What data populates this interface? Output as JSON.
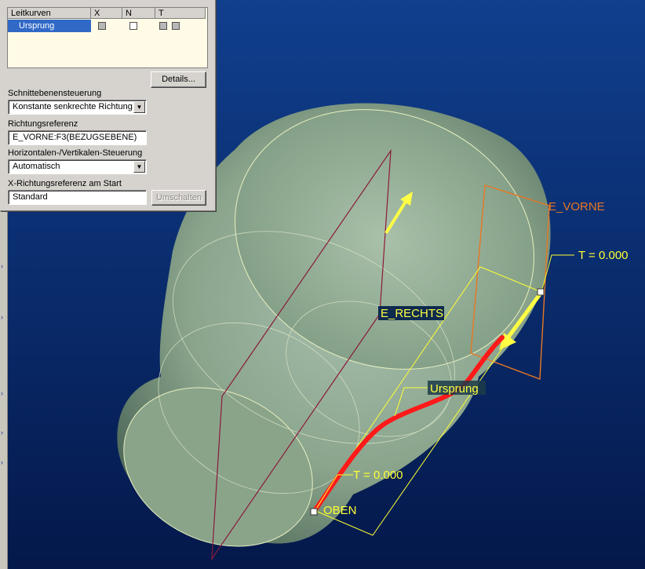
{
  "panel": {
    "table": {
      "columns": [
        "Leitkurven",
        "X",
        "N",
        "T"
      ],
      "rows": [
        {
          "name": "Ursprung"
        }
      ]
    },
    "details_button": "Details...",
    "section_control": {
      "label": "Schnittebenensteuerung",
      "value": "Konstante senkrechte Richtung"
    },
    "direction_ref": {
      "label": "Richtungsreferenz",
      "value": "E_VORNE:F3(BEZUGSEBENE)"
    },
    "hv_control": {
      "label": "Horizontalen-/Vertikalen-Steuerung",
      "value": "Automatisch"
    },
    "x_ref": {
      "label": "X-Richtungsreferenz am Start",
      "value": "Standard",
      "toggle_button": "Umschalten"
    }
  },
  "viewport": {
    "labels": {
      "plane_front": "E_VORNE",
      "plane_right": "E_RECHTS",
      "plane_top": "OBEN",
      "curve": "Ursprung",
      "t_start_upper": "T = 0.000",
      "t_start_lower": "T = 0.000"
    },
    "colors": {
      "background_top": "#0f3f8c",
      "background_bottom": "#061b4a",
      "body": "#8fa88f",
      "plane_front": "#e87722",
      "plane_right": "#8b1a3a",
      "curve": "#ff1a1a",
      "annotation": "#ffff33"
    }
  }
}
